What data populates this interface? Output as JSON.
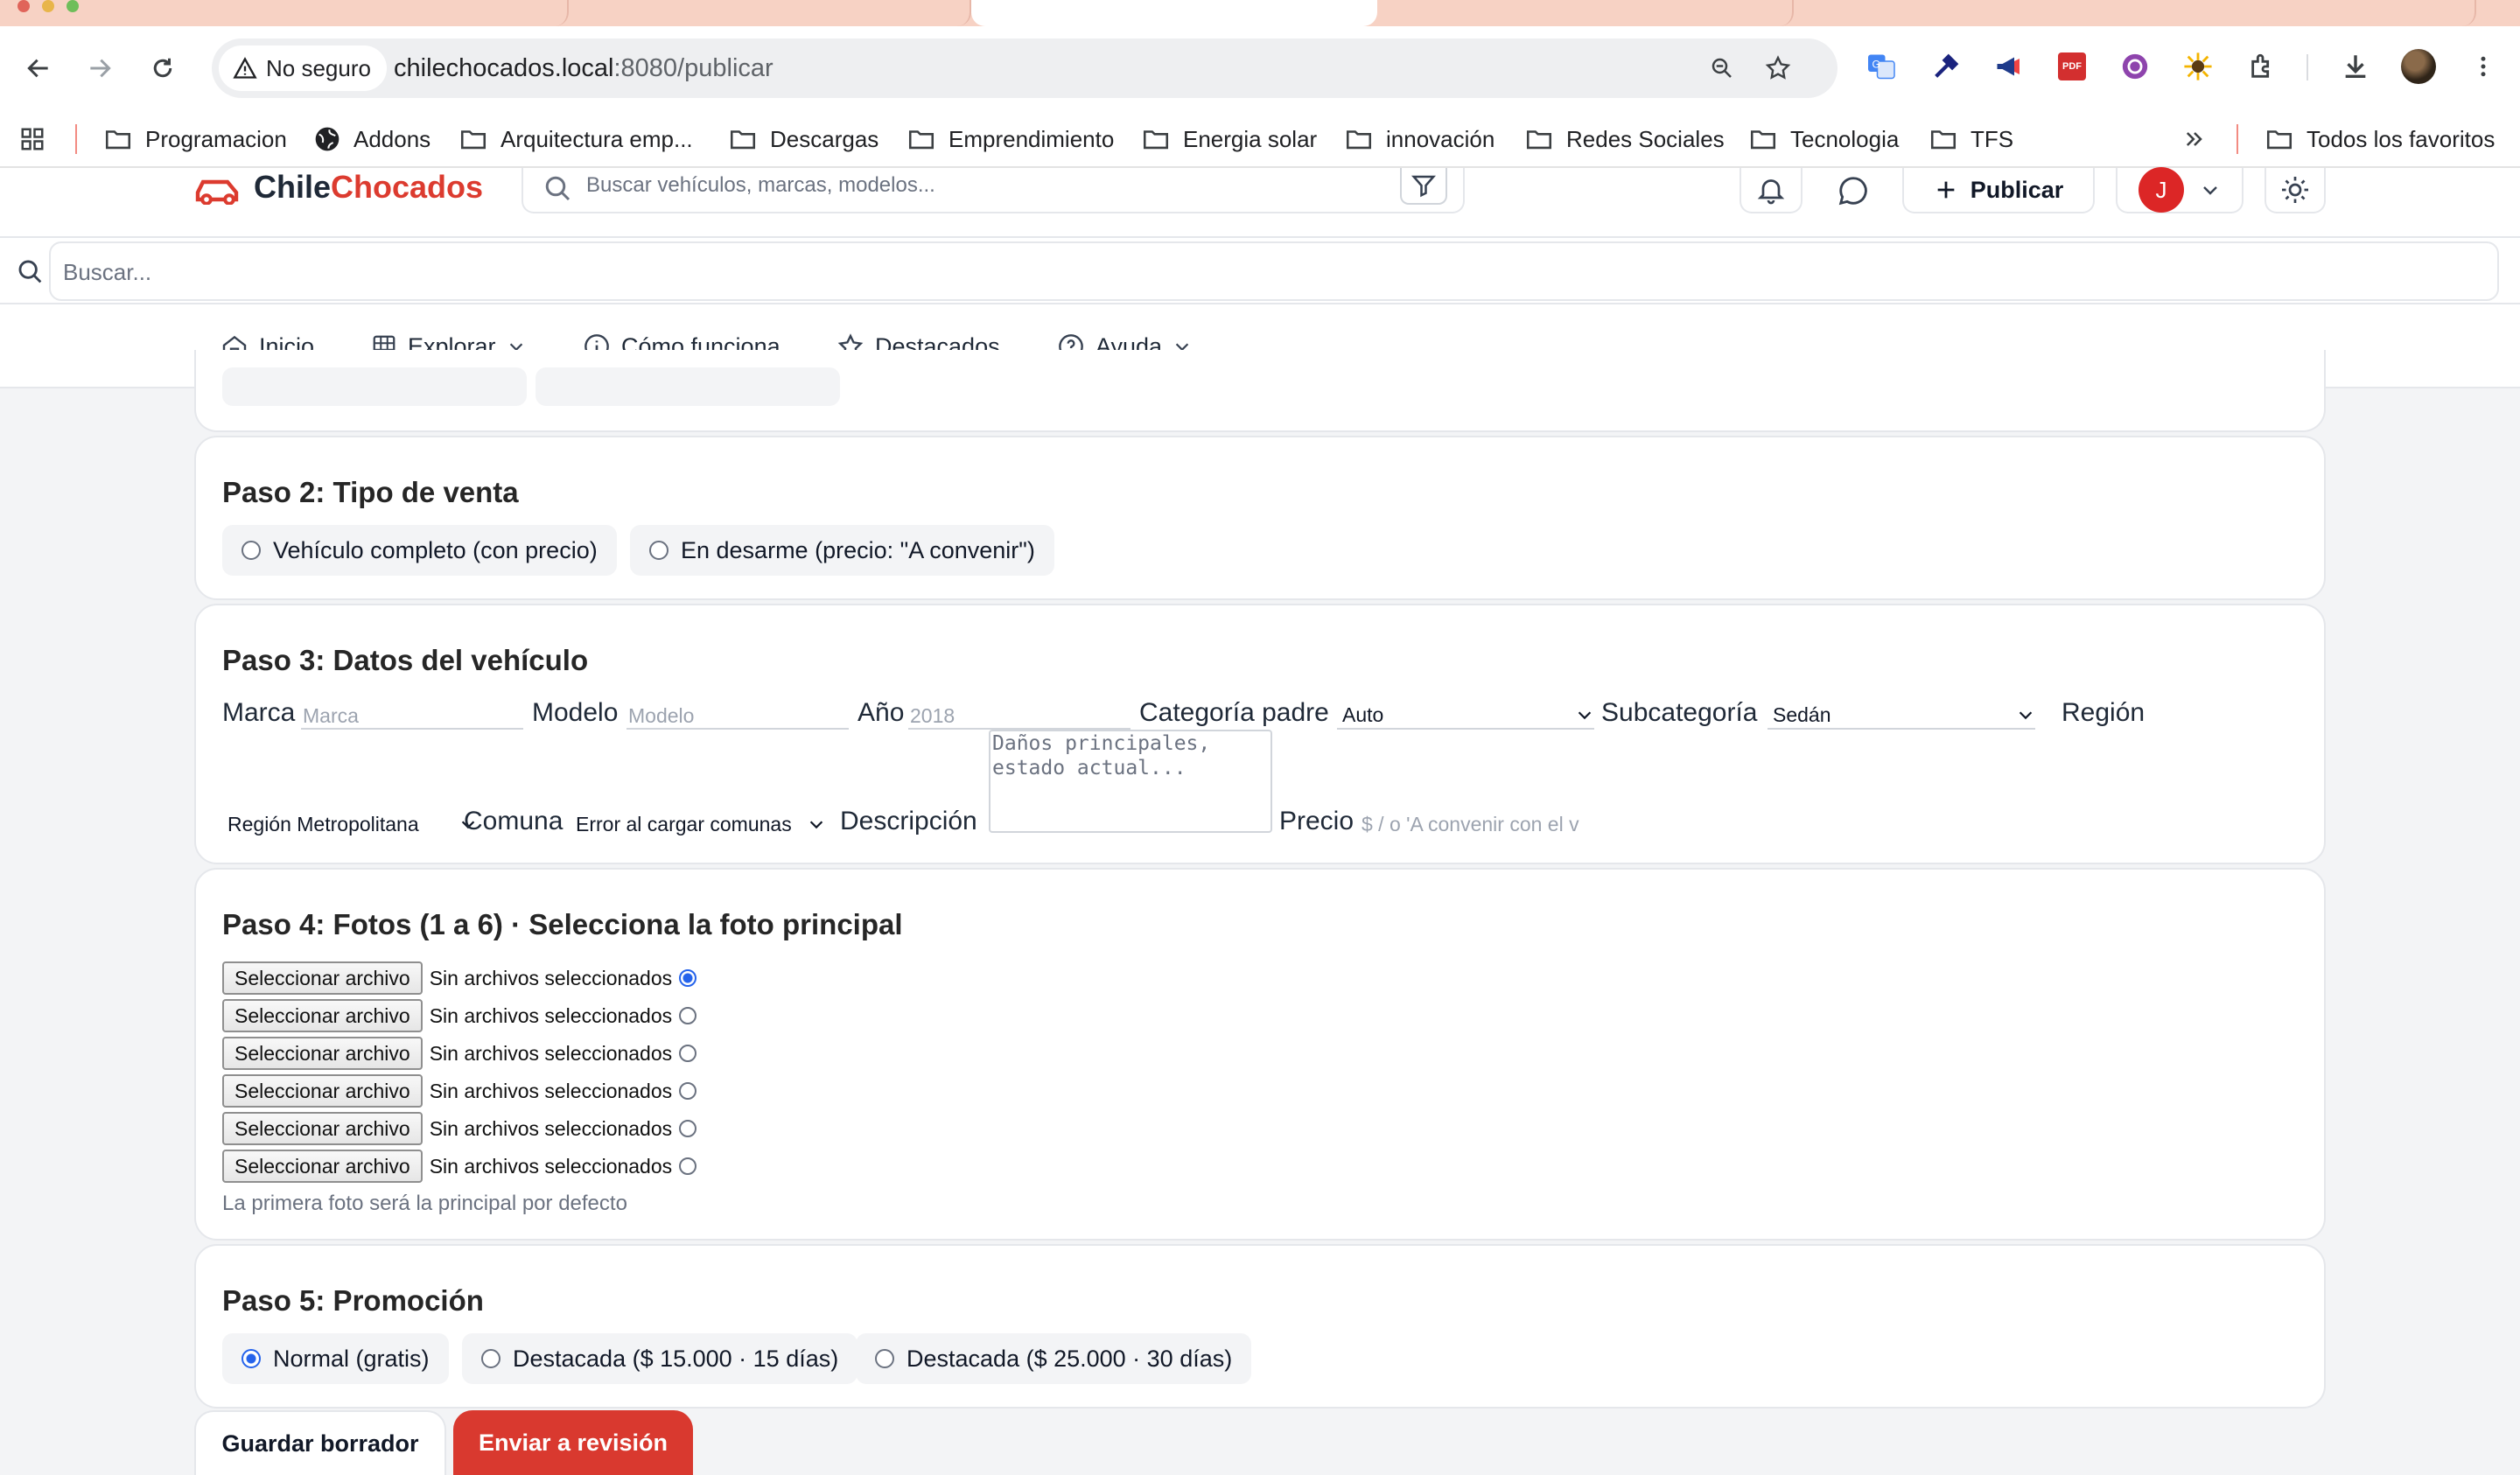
{
  "browser": {
    "security_label": "No seguro",
    "url_host": "chilechocados.local",
    "url_path": ":8080/publicar",
    "bookmarks": [
      "Programacion",
      "Addons",
      "Arquitectura emp...",
      "Descargas",
      "Emprendimiento",
      "Energia solar",
      "innovación",
      "Redes Sociales",
      "Tecnologia",
      "TFS"
    ],
    "all_bookmarks": "Todos los favoritos",
    "pdf_ext": "PDF"
  },
  "app": {
    "logo_part1": "Chile",
    "logo_part2": "Chocados",
    "search_placeholder": "Buscar vehículos, marcas, modelos...",
    "publish_label": "Publicar",
    "avatar_initial": "J",
    "secondary_search_placeholder": "Buscar...",
    "nav": {
      "inicio": "Inicio",
      "explorar": "Explorar",
      "como_funciona": "Cómo funciona",
      "destacados": "Destacados",
      "ayuda": "Ayuda"
    }
  },
  "step2": {
    "title": "Paso 2: Tipo de venta",
    "option_complete": "Vehículo completo (con precio)",
    "option_parts": "En desarme (precio: \"A convenir\")"
  },
  "step3": {
    "title": "Paso 3: Datos del vehículo",
    "marca_label": "Marca",
    "marca_placeholder": "Marca",
    "modelo_label": "Modelo",
    "modelo_placeholder": "Modelo",
    "anio_label": "Año",
    "anio_placeholder": "2018",
    "categoria_label": "Categoría padre",
    "categoria_value": "Auto",
    "subcategoria_label": "Subcategoría",
    "subcategoria_value": "Sedán",
    "region_label": "Región",
    "region_value": "Región Metropolitana",
    "comuna_label": "Comuna",
    "comuna_value": "Error al cargar comunas",
    "descripcion_label": "Descripción",
    "descripcion_placeholder": "Daños principales,\nestado actual...",
    "precio_label": "Precio",
    "precio_placeholder": "$ / o 'A convenir con el v"
  },
  "step4": {
    "title": "Paso 4: Fotos (1 a 6) · Selecciona la foto principal",
    "file_button": "Seleccionar archivo",
    "no_file": "Sin archivos seleccionados",
    "hint": "La primera foto será la principal por defecto"
  },
  "step5": {
    "title": "Paso 5: Promoción",
    "option_normal": "Normal (gratis)",
    "option_15": "Destacada ($ 15.000 · 15 días)",
    "option_30": "Destacada ($ 25.000 · 30 días)"
  },
  "actions": {
    "save_draft": "Guardar borrador",
    "submit": "Enviar a revisión"
  },
  "colors": {
    "brand_red": "#dc3b2f",
    "radio_blue": "#2563eb",
    "tab_strip": "#f7d2c4"
  }
}
